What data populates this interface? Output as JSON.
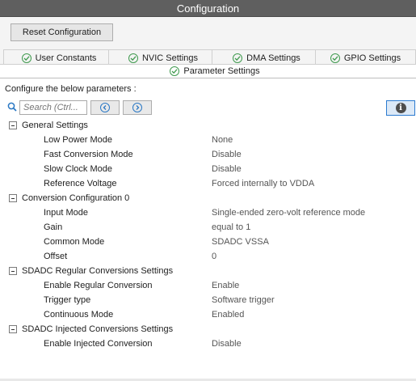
{
  "window": {
    "title": "Configuration"
  },
  "toolbar": {
    "reset_label": "Reset Configuration"
  },
  "tabs": [
    {
      "label": "User Constants",
      "icon": "check-circle-icon"
    },
    {
      "label": "NVIC Settings",
      "icon": "check-circle-icon"
    },
    {
      "label": "DMA Settings",
      "icon": "check-circle-icon"
    },
    {
      "label": "GPIO Settings",
      "icon": "check-circle-icon"
    }
  ],
  "active_tab": {
    "label": "Parameter Settings",
    "icon": "check-circle-icon"
  },
  "configure_label": "Configure the below parameters :",
  "search": {
    "placeholder": "Search (Ctrl..."
  },
  "colors": {
    "check_green": "#3f9a4e",
    "nav_blue": "#2a78c4",
    "title_bg": "#5f5f5f"
  },
  "groups": [
    {
      "label": "General Settings",
      "params": [
        {
          "label": "Low Power Mode",
          "value": "None"
        },
        {
          "label": "Fast Conversion Mode",
          "value": "Disable"
        },
        {
          "label": "Slow Clock Mode",
          "value": "Disable"
        },
        {
          "label": "Reference Voltage",
          "value": "Forced internally to VDDA"
        }
      ]
    },
    {
      "label": "Conversion Configuration 0",
      "params": [
        {
          "label": "Input Mode",
          "value": "Single-ended zero-volt reference mode"
        },
        {
          "label": "Gain",
          "value": "equal to 1"
        },
        {
          "label": "Common Mode",
          "value": "SDADC VSSA"
        },
        {
          "label": "Offset",
          "value": "0"
        }
      ]
    },
    {
      "label": "SDADC Regular Conversions Settings",
      "params": [
        {
          "label": "Enable Regular Conversion",
          "value": "Enable"
        },
        {
          "label": "Trigger type",
          "value": "Software trigger"
        },
        {
          "label": "Continuous Mode",
          "value": "Enabled"
        }
      ]
    },
    {
      "label": "SDADC Injected Conversions Settings",
      "params": [
        {
          "label": "Enable Injected Conversion",
          "value": "Disable"
        }
      ]
    }
  ]
}
